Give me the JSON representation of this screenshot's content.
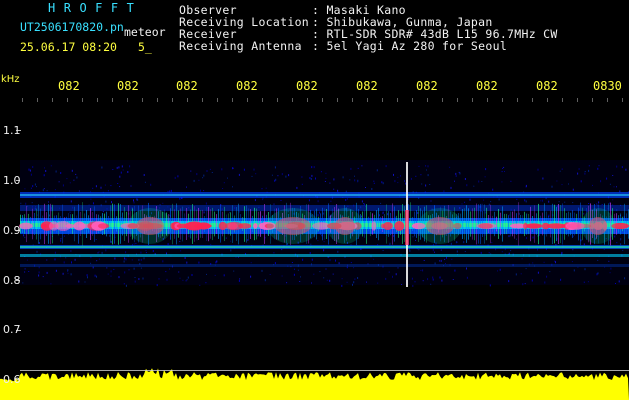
{
  "logo": "HROFFT",
  "file_name": "UT2506170820.pn",
  "meteor_label": "meteor",
  "datetime": "25.06.17 08:20",
  "sub_label": "5_",
  "info": {
    "observer_key": "Observer",
    "observer_val": ": Masaki Kano",
    "location_key": "Receiving Location",
    "location_val": ": Shibukawa, Gunma, Japan",
    "receiver_key": "Receiver",
    "receiver_val": ": RTL-SDR SDR# 43dB L15 96.7MHz CW",
    "antenna_key": "Receiving Antenna",
    "antenna_val": ": 5el Yagi Az 280 for Seoul"
  },
  "y_unit": "kHz",
  "time_ticks": [
    "082",
    "082",
    "082",
    "082",
    "082",
    "082",
    "082",
    "082",
    "082",
    "0830"
  ],
  "freq_ticks": [
    "1.1",
    "1.0",
    "0.9",
    "0.8",
    "0.7",
    "0.6"
  ],
  "colors": {
    "text": "#f2f2f2",
    "accent": "#39e0ff",
    "tick": "#ffff40",
    "signal": "#ffff00"
  }
}
